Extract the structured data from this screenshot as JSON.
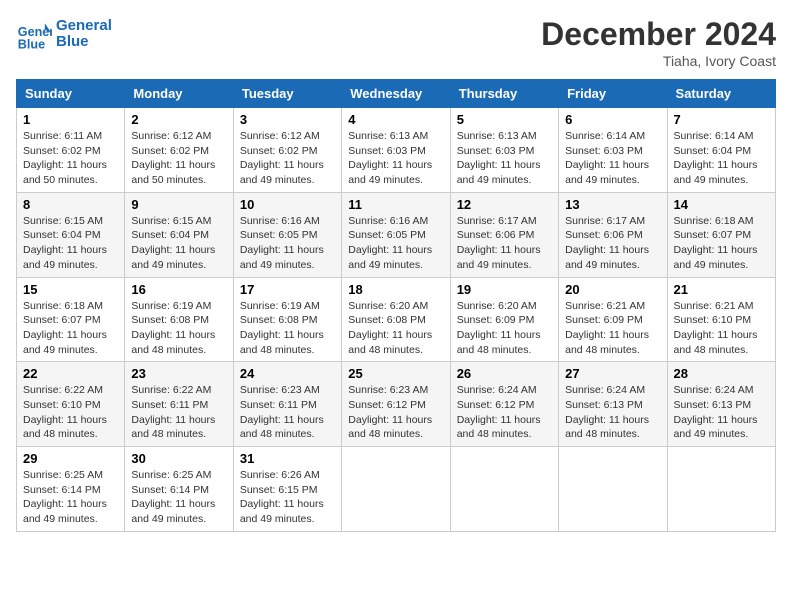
{
  "header": {
    "logo_line1": "General",
    "logo_line2": "Blue",
    "month": "December 2024",
    "location": "Tiaha, Ivory Coast"
  },
  "days_of_week": [
    "Sunday",
    "Monday",
    "Tuesday",
    "Wednesday",
    "Thursday",
    "Friday",
    "Saturday"
  ],
  "weeks": [
    [
      {
        "day": "1",
        "info": "Sunrise: 6:11 AM\nSunset: 6:02 PM\nDaylight: 11 hours\nand 50 minutes."
      },
      {
        "day": "2",
        "info": "Sunrise: 6:12 AM\nSunset: 6:02 PM\nDaylight: 11 hours\nand 50 minutes."
      },
      {
        "day": "3",
        "info": "Sunrise: 6:12 AM\nSunset: 6:02 PM\nDaylight: 11 hours\nand 49 minutes."
      },
      {
        "day": "4",
        "info": "Sunrise: 6:13 AM\nSunset: 6:03 PM\nDaylight: 11 hours\nand 49 minutes."
      },
      {
        "day": "5",
        "info": "Sunrise: 6:13 AM\nSunset: 6:03 PM\nDaylight: 11 hours\nand 49 minutes."
      },
      {
        "day": "6",
        "info": "Sunrise: 6:14 AM\nSunset: 6:03 PM\nDaylight: 11 hours\nand 49 minutes."
      },
      {
        "day": "7",
        "info": "Sunrise: 6:14 AM\nSunset: 6:04 PM\nDaylight: 11 hours\nand 49 minutes."
      }
    ],
    [
      {
        "day": "8",
        "info": "Sunrise: 6:15 AM\nSunset: 6:04 PM\nDaylight: 11 hours\nand 49 minutes."
      },
      {
        "day": "9",
        "info": "Sunrise: 6:15 AM\nSunset: 6:04 PM\nDaylight: 11 hours\nand 49 minutes."
      },
      {
        "day": "10",
        "info": "Sunrise: 6:16 AM\nSunset: 6:05 PM\nDaylight: 11 hours\nand 49 minutes."
      },
      {
        "day": "11",
        "info": "Sunrise: 6:16 AM\nSunset: 6:05 PM\nDaylight: 11 hours\nand 49 minutes."
      },
      {
        "day": "12",
        "info": "Sunrise: 6:17 AM\nSunset: 6:06 PM\nDaylight: 11 hours\nand 49 minutes."
      },
      {
        "day": "13",
        "info": "Sunrise: 6:17 AM\nSunset: 6:06 PM\nDaylight: 11 hours\nand 49 minutes."
      },
      {
        "day": "14",
        "info": "Sunrise: 6:18 AM\nSunset: 6:07 PM\nDaylight: 11 hours\nand 49 minutes."
      }
    ],
    [
      {
        "day": "15",
        "info": "Sunrise: 6:18 AM\nSunset: 6:07 PM\nDaylight: 11 hours\nand 49 minutes."
      },
      {
        "day": "16",
        "info": "Sunrise: 6:19 AM\nSunset: 6:08 PM\nDaylight: 11 hours\nand 48 minutes."
      },
      {
        "day": "17",
        "info": "Sunrise: 6:19 AM\nSunset: 6:08 PM\nDaylight: 11 hours\nand 48 minutes."
      },
      {
        "day": "18",
        "info": "Sunrise: 6:20 AM\nSunset: 6:08 PM\nDaylight: 11 hours\nand 48 minutes."
      },
      {
        "day": "19",
        "info": "Sunrise: 6:20 AM\nSunset: 6:09 PM\nDaylight: 11 hours\nand 48 minutes."
      },
      {
        "day": "20",
        "info": "Sunrise: 6:21 AM\nSunset: 6:09 PM\nDaylight: 11 hours\nand 48 minutes."
      },
      {
        "day": "21",
        "info": "Sunrise: 6:21 AM\nSunset: 6:10 PM\nDaylight: 11 hours\nand 48 minutes."
      }
    ],
    [
      {
        "day": "22",
        "info": "Sunrise: 6:22 AM\nSunset: 6:10 PM\nDaylight: 11 hours\nand 48 minutes."
      },
      {
        "day": "23",
        "info": "Sunrise: 6:22 AM\nSunset: 6:11 PM\nDaylight: 11 hours\nand 48 minutes."
      },
      {
        "day": "24",
        "info": "Sunrise: 6:23 AM\nSunset: 6:11 PM\nDaylight: 11 hours\nand 48 minutes."
      },
      {
        "day": "25",
        "info": "Sunrise: 6:23 AM\nSunset: 6:12 PM\nDaylight: 11 hours\nand 48 minutes."
      },
      {
        "day": "26",
        "info": "Sunrise: 6:24 AM\nSunset: 6:12 PM\nDaylight: 11 hours\nand 48 minutes."
      },
      {
        "day": "27",
        "info": "Sunrise: 6:24 AM\nSunset: 6:13 PM\nDaylight: 11 hours\nand 48 minutes."
      },
      {
        "day": "28",
        "info": "Sunrise: 6:24 AM\nSunset: 6:13 PM\nDaylight: 11 hours\nand 49 minutes."
      }
    ],
    [
      {
        "day": "29",
        "info": "Sunrise: 6:25 AM\nSunset: 6:14 PM\nDaylight: 11 hours\nand 49 minutes."
      },
      {
        "day": "30",
        "info": "Sunrise: 6:25 AM\nSunset: 6:14 PM\nDaylight: 11 hours\nand 49 minutes."
      },
      {
        "day": "31",
        "info": "Sunrise: 6:26 AM\nSunset: 6:15 PM\nDaylight: 11 hours\nand 49 minutes."
      },
      {
        "day": "",
        "info": ""
      },
      {
        "day": "",
        "info": ""
      },
      {
        "day": "",
        "info": ""
      },
      {
        "day": "",
        "info": ""
      }
    ]
  ]
}
